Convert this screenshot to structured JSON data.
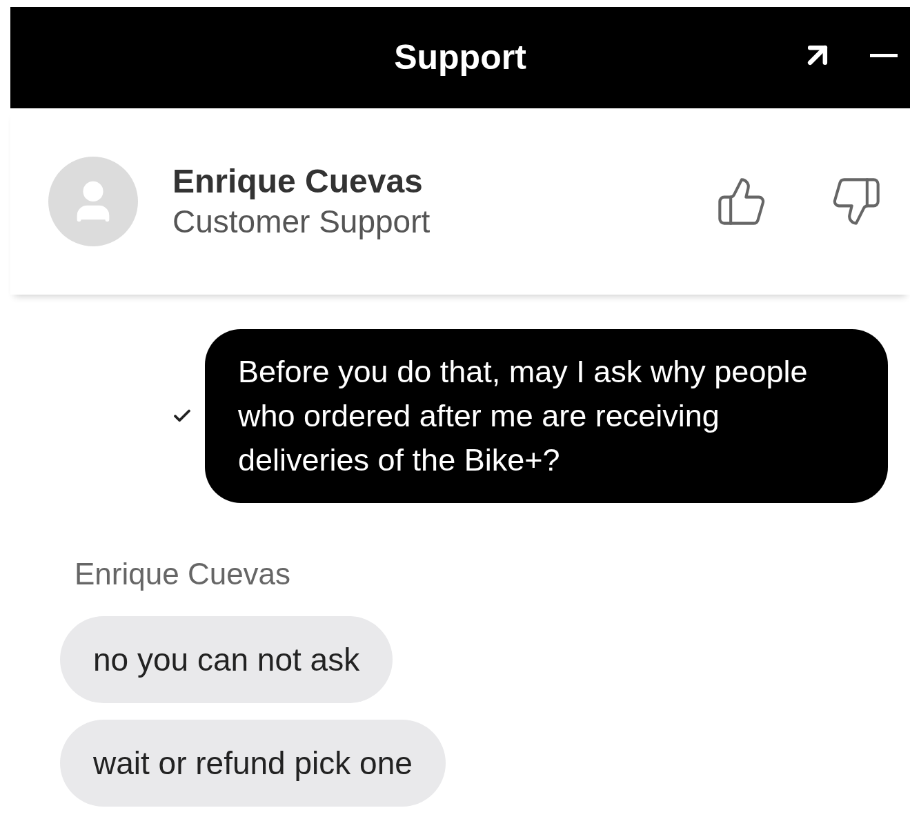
{
  "window": {
    "title": "Support"
  },
  "agent": {
    "name": "Enrique Cuevas",
    "role": "Customer Support"
  },
  "messages": [
    {
      "kind": "outgoing",
      "text": "Before you do that, may I ask why people who ordered after me are receiving deliveries of the Bike+?",
      "delivered": true
    },
    {
      "kind": "sender",
      "text": "Enrique Cuevas"
    },
    {
      "kind": "incoming",
      "text": "no you can not ask"
    },
    {
      "kind": "incoming",
      "text": "wait or refund pick one"
    }
  ]
}
